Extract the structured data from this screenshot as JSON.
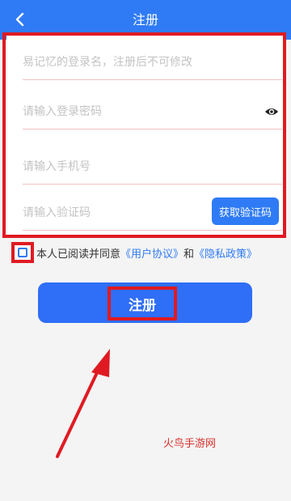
{
  "header": {
    "title": "注册"
  },
  "form": {
    "username_placeholder": "易记忆的登录名，注册后不可修改",
    "password_placeholder": "请输入登录密码",
    "phone_placeholder": "请输入手机号",
    "code_placeholder": "请输入验证码",
    "get_code_label": "获取验证码"
  },
  "agreement": {
    "prefix": "本人已阅读并同意",
    "user_agreement": "《用户协议》",
    "conjunction": "和",
    "privacy_policy": "《隐私政策》"
  },
  "submit": {
    "label": "注册"
  },
  "watermark": "火鸟手游网",
  "colors": {
    "primary": "#2f7bf5",
    "highlight_red": "#e01a22",
    "background": "#f4f4f4"
  }
}
